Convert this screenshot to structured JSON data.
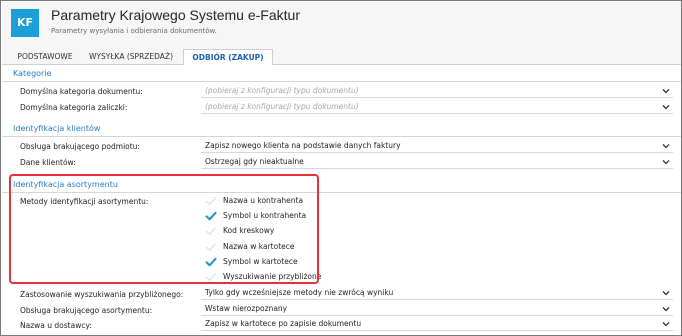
{
  "header": {
    "logo": "KF",
    "title": "Parametry Krajowego Systemu e-Faktur",
    "subtitle": "Parametry wysyłania i odbierania dokumentów."
  },
  "tabs": [
    {
      "label": "PODSTAWOWE",
      "active": false
    },
    {
      "label": "WYSYŁKA (SPRZEDAŻ)",
      "active": false
    },
    {
      "label": "ODBIÓR (ZAKUP)",
      "active": true
    }
  ],
  "sections": {
    "kategorie": {
      "title": "Kategorie",
      "rows": [
        {
          "label": "Domyślna kategoria dokumentu:",
          "value": "(pobieraj z konfiguracji typu dokumentu)"
        },
        {
          "label": "Domyślna kategoria zaliczki:",
          "value": "(pobieraj z konfiguracji typu dokumentu)"
        }
      ]
    },
    "klienci": {
      "title": "Identyfikacja klientów",
      "rows": [
        {
          "label": "Obsługa brakującego podmiotu:",
          "value": "Zapisz nowego klienta na podstawie danych faktury"
        },
        {
          "label": "Dane klientów:",
          "value": "Ostrzegaj gdy nieaktualne"
        }
      ]
    },
    "asortyment": {
      "title": "Identyfikacja asortymentu",
      "methods_label": "Metody identyfikacji asortymentu:",
      "methods": [
        {
          "label": "Nazwa u kontrahenta",
          "checked": false
        },
        {
          "label": "Symbol u kontrahenta",
          "checked": true
        },
        {
          "label": "Kod kreskowy",
          "checked": false
        },
        {
          "label": "Nazwa w kartotece",
          "checked": false
        },
        {
          "label": "Symbol w kartotece",
          "checked": true
        },
        {
          "label": "Wyszukiwanie przybliżone",
          "checked": false
        }
      ],
      "rows": [
        {
          "label": "Zastosowanie wyszukiwania przybliżonego:",
          "value": "Tylko gdy wcześniejsze metody nie zwrócą wyniku"
        },
        {
          "label": "Obsługa brakującego asortymentu:",
          "value": "Wstaw nierozpoznany"
        },
        {
          "label": "Nazwa u dostawcy:",
          "value": "Zapisz w kartotece po zapisie dokumentu"
        }
      ]
    }
  },
  "colors": {
    "accent": "#1c9fd8",
    "section_title": "#2a7fc4",
    "check": "#1c8fd0",
    "highlight": "#e5313a"
  },
  "icons": {
    "dropdown": "chevron-down-icon",
    "checked": "checkmark-icon"
  }
}
